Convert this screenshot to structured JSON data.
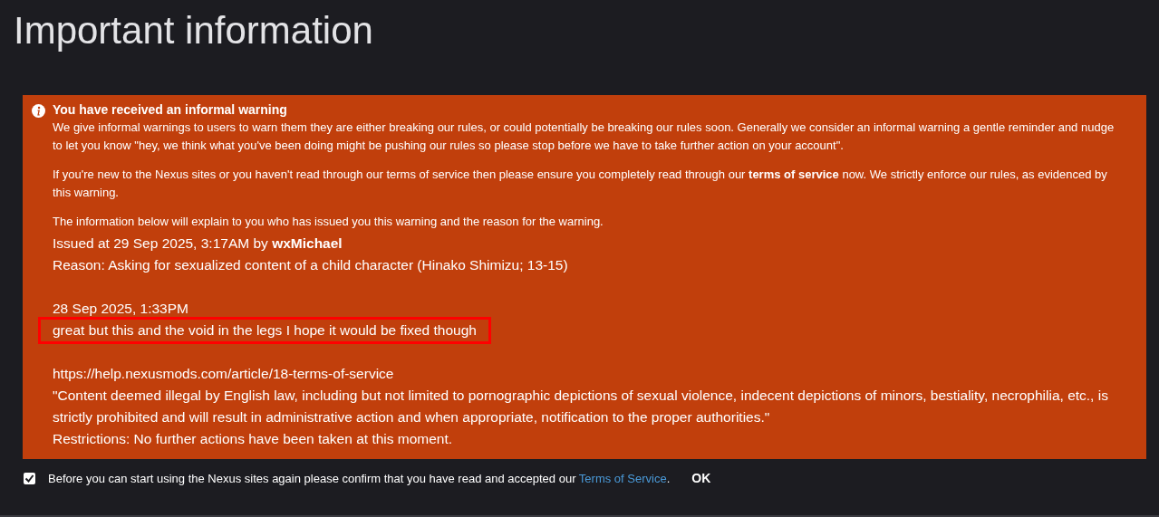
{
  "page_title": "Important information",
  "warning": {
    "title": "You have received an informal warning",
    "paragraphs": [
      "We give informal warnings to users to warn them they are either breaking our rules, or could potentially be breaking our rules soon. Generally we consider an informal warning a gentle reminder and nudge to let you know \"hey, we think what you've been doing might be pushing our rules so please stop before we have to take further action on your account\".",
      "If you're new to the Nexus sites or you haven't read through our terms of service then please ensure you completely read through our **terms of service** now. We strictly enforce our rules, as evidenced by this warning.",
      "The information below will explain to you who has issued you this warning and the reason for the warning."
    ],
    "details": [
      [
        {
          "text": "Issued at 29 Sep 2025, 3:17AM by **wxMichael**",
          "highlighted": false
        },
        {
          "text": "Reason: Asking for sexualized content of a child character (Hinako Shimizu; 13-15)",
          "highlighted": false
        }
      ],
      [
        {
          "text": "28 Sep 2025, 1:33PM",
          "highlighted": false
        },
        {
          "text": "great but this and the void in the legs I hope it would be fixed though",
          "highlighted": true
        }
      ],
      [
        {
          "text": "https://help.nexusmods.com/article/18-terms-of-service",
          "highlighted": false
        },
        {
          "text": "\"Content deemed illegal by English law, including but not limited to pornographic depictions of sexual violence, indecent depictions of minors, bestiality, necrophilia, etc., is strictly prohibited and will result in administrative action and when appropriate, notification to the proper authorities.\"",
          "highlighted": false
        },
        {
          "text": "Restrictions: No further actions have been taken at this moment.",
          "highlighted": false
        }
      ]
    ]
  },
  "confirm": {
    "checked": true,
    "text_before": "Before you can start using the Nexus sites again please confirm that you have read and accepted our",
    "link": "Terms of Service",
    "text_after": ".",
    "button": "OK"
  }
}
